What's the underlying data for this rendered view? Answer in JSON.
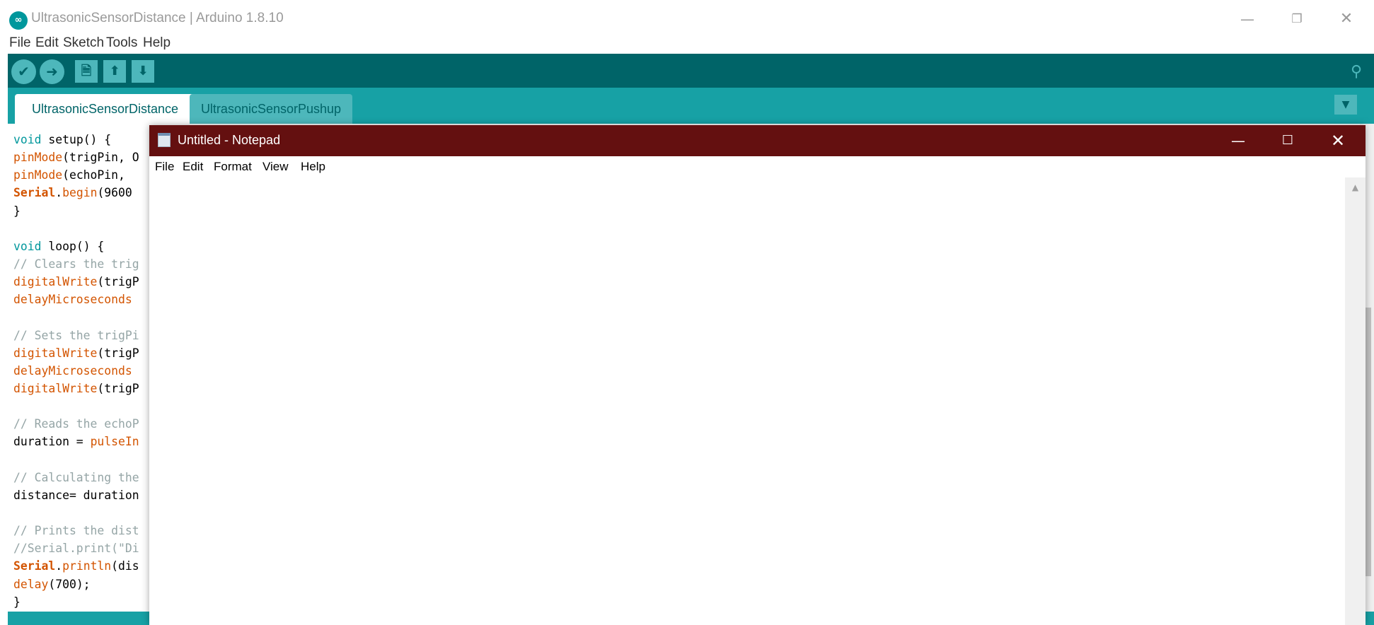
{
  "arduino": {
    "window_title": "UltrasonicSensorDistance | Arduino 1.8.10",
    "logo_glyph": "∞",
    "window_buttons": {
      "minimize": "—",
      "restore": "❐",
      "close": "✕"
    },
    "menu": [
      "File",
      "Edit",
      "Sketch",
      "Tools",
      "Help"
    ],
    "toolbar": {
      "verify_icon": "✔",
      "upload_icon": "➜",
      "new_icon": "🗎",
      "open_icon": "⬆",
      "save_icon": "⬇",
      "serial_monitor_icon": "⚲"
    },
    "tabs": [
      {
        "label": "UltrasonicSensorDistance",
        "active": true
      },
      {
        "label": "UltrasonicSensorPushup",
        "active": false
      }
    ],
    "tab_menu_icon": "▼",
    "code": [
      [
        [
          "kw",
          "void"
        ],
        [
          "txt",
          " setup() {"
        ]
      ],
      [
        [
          "fn",
          "pinMode"
        ],
        [
          "txt",
          "(trigPin, O"
        ]
      ],
      [
        [
          "fn",
          "pinMode"
        ],
        [
          "txt",
          "(echoPin, "
        ]
      ],
      [
        [
          "ser",
          "Serial"
        ],
        [
          "txt",
          "."
        ],
        [
          "fn",
          "begin"
        ],
        [
          "txt",
          "(9600"
        ]
      ],
      [
        [
          "txt",
          "}"
        ]
      ],
      [
        [
          "txt",
          ""
        ]
      ],
      [
        [
          "kw",
          "void"
        ],
        [
          "txt",
          " loop() {"
        ]
      ],
      [
        [
          "cm",
          "// Clears the trig"
        ]
      ],
      [
        [
          "fn",
          "digitalWrite"
        ],
        [
          "txt",
          "(trigP"
        ]
      ],
      [
        [
          "fn",
          "delayMicroseconds"
        ]
      ],
      [
        [
          "txt",
          ""
        ]
      ],
      [
        [
          "cm",
          "// Sets the trigPi"
        ]
      ],
      [
        [
          "fn",
          "digitalWrite"
        ],
        [
          "txt",
          "(trigP"
        ]
      ],
      [
        [
          "fn",
          "delayMicroseconds"
        ]
      ],
      [
        [
          "fn",
          "digitalWrite"
        ],
        [
          "txt",
          "(trigP"
        ]
      ],
      [
        [
          "txt",
          ""
        ]
      ],
      [
        [
          "cm",
          "// Reads the echoP"
        ]
      ],
      [
        [
          "txt",
          "duration = "
        ],
        [
          "fn",
          "pulseIn"
        ]
      ],
      [
        [
          "txt",
          ""
        ]
      ],
      [
        [
          "cm",
          "// Calculating the"
        ]
      ],
      [
        [
          "txt",
          "distance= duration"
        ]
      ],
      [
        [
          "txt",
          ""
        ]
      ],
      [
        [
          "cm",
          "// Prints the dist"
        ]
      ],
      [
        [
          "cm",
          "//Serial.print(\"Di"
        ]
      ],
      [
        [
          "ser",
          "Serial"
        ],
        [
          "txt",
          "."
        ],
        [
          "fn",
          "println"
        ],
        [
          "txt",
          "(dis"
        ]
      ],
      [
        [
          "fn",
          "delay"
        ],
        [
          "txt",
          "(700);"
        ]
      ],
      [
        [
          "txt",
          "}"
        ]
      ]
    ]
  },
  "notepad": {
    "window_title": "Untitled - Notepad",
    "window_buttons": {
      "minimize": "—",
      "maximize": "☐",
      "close": "✕"
    },
    "menu": [
      "File",
      "Edit",
      "Format",
      "View",
      "Help"
    ],
    "text": "",
    "scroll_up_icon": "▲"
  },
  "colors": {
    "arduino_teal_dark": "#006468",
    "arduino_teal": "#17a1a5",
    "arduino_teal_light": "#4db7bb",
    "notepad_titlebar": "#641010",
    "keyword": "#00979c",
    "function": "#d35400",
    "comment": "#95a5a6"
  }
}
